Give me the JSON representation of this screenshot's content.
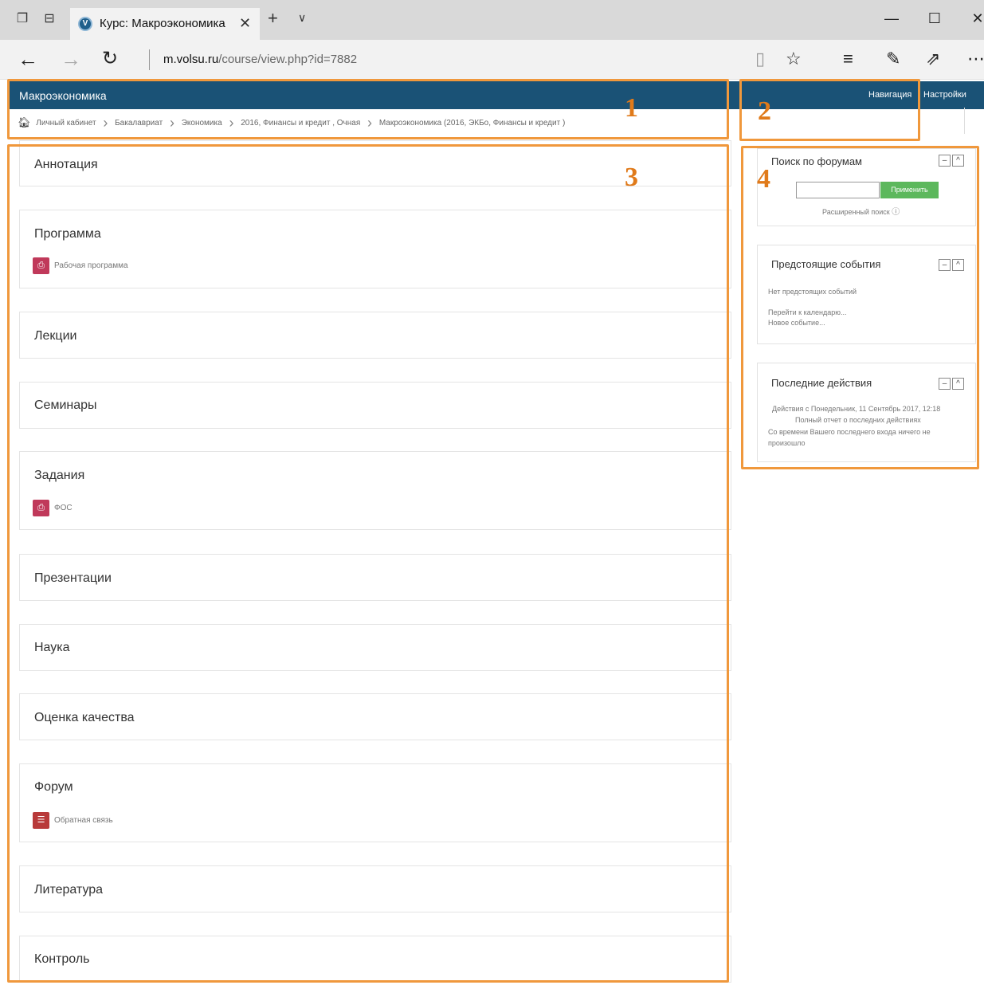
{
  "browser": {
    "tab_title": "Курс: Макроэкономика",
    "tab_logo": "V",
    "url_domain": "m.volsu.ru",
    "url_path": "/course/view.php?id=7882",
    "icons": [
      "tab-preview-icon",
      "set-aside-tabs-icon",
      "close-icon",
      "new-tab-icon",
      "tab-list-icon",
      "minimize-icon",
      "maximize-icon",
      "back-icon",
      "forward-icon",
      "refresh-icon",
      "reading-view-icon",
      "favorite-star-icon",
      "hub-icon",
      "web-note-icon",
      "share-icon",
      "more-icon"
    ]
  },
  "header": {
    "course_title": "Макроэкономика",
    "nav_link": "Навигация",
    "settings_link": "Настройки",
    "background_color": "#1a5276"
  },
  "breadcrumb": [
    "Личный кабинет",
    "Бакалавриат",
    "Экономика",
    "2016, Финансы и кредит , Очная",
    "Макроэкономика (2016, ЭКБо, Финансы и кредит )"
  ],
  "sections": [
    {
      "title": "Аннотация"
    },
    {
      "title": "Программа",
      "activity": "Рабочая программа"
    },
    {
      "title": "Лекции"
    },
    {
      "title": "Семинары"
    },
    {
      "title": "Задания",
      "activity": "ФОС"
    },
    {
      "title": "Презентации"
    },
    {
      "title": "Наука"
    },
    {
      "title": "Оценка качества"
    },
    {
      "title": "Форум",
      "activity": "Обратная связь"
    },
    {
      "title": "Литература"
    },
    {
      "title": "Контроль"
    }
  ],
  "blocks": {
    "forum_search": {
      "title": "Поиск по форумам",
      "apply_button": "Применить",
      "advanced_search": "Расширенный поиск"
    },
    "upcoming": {
      "title": "Предстоящие события",
      "empty": "Нет предстоящих событий",
      "goto_calendar": "Перейти к календарю...",
      "new_event": "Новое событие..."
    },
    "recent": {
      "title": "Последние действия",
      "since": "Действия с Понедельник, 11 Сентябрь 2017, 12:18",
      "full_report": "Полный отчет о последних действиях",
      "nothing": "Со времени Вашего последнего входа ничего не",
      "nothing_2": "произошло"
    }
  },
  "annotations": [
    "1",
    "2",
    "3",
    "4"
  ],
  "colors": {
    "annotation": "#f0983c",
    "apply_button": "#5cb85c"
  }
}
